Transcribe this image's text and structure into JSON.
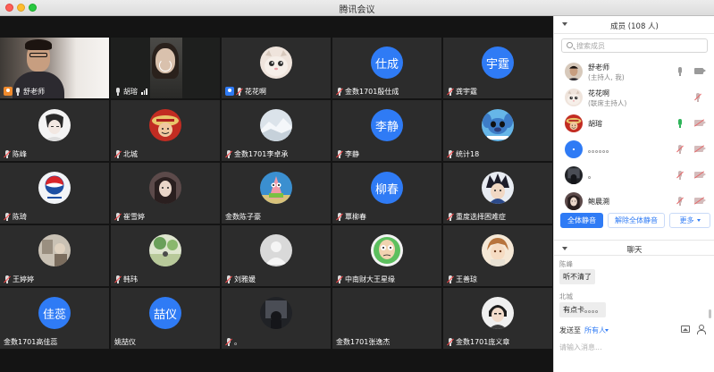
{
  "window": {
    "title": "腾讯会议"
  },
  "tiles": [
    {
      "name": "舒老师",
      "kind": "video1",
      "host": true,
      "mic": "on"
    },
    {
      "name": "胡瑢",
      "kind": "video2",
      "mic": "on",
      "active": true,
      "signal": true
    },
    {
      "name": "花花啊",
      "kind": "cat",
      "cohost": true,
      "mic": "muted"
    },
    {
      "name": "金数1701殷仕成",
      "kind": "text",
      "initials": "仕成",
      "mic": "muted"
    },
    {
      "name": "龚宇霆",
      "kind": "text",
      "initials": "宇霆",
      "mic": "muted"
    },
    {
      "name": "陈峰",
      "kind": "sketch",
      "mic": "muted"
    },
    {
      "name": "北城",
      "kind": "luffy",
      "mic": "muted"
    },
    {
      "name": "金数1701李卓承",
      "kind": "snow",
      "mic": "muted"
    },
    {
      "name": "李静",
      "kind": "text",
      "initials": "李静",
      "mic": "muted"
    },
    {
      "name": "统计18",
      "kind": "stitch",
      "mic": "muted"
    },
    {
      "name": "陈琦",
      "kind": "pepsi",
      "mic": "muted"
    },
    {
      "name": "崔雪婷",
      "kind": "girl",
      "mic": "muted"
    },
    {
      "name": "金数陈子豪",
      "kind": "patrick",
      "mic": "none"
    },
    {
      "name": "覃柳春",
      "kind": "text",
      "initials": "柳春",
      "mic": "muted"
    },
    {
      "name": "重度选择困难症",
      "kind": "anime",
      "mic": "muted"
    },
    {
      "name": "王婷婷",
      "kind": "room",
      "mic": "muted"
    },
    {
      "name": "韩玮",
      "kind": "field",
      "mic": "muted"
    },
    {
      "name": "刘雅媛",
      "kind": "default",
      "mic": "muted"
    },
    {
      "name": "中南财大王星缘",
      "kind": "morty",
      "mic": "muted"
    },
    {
      "name": "王善琼",
      "kind": "boy",
      "mic": "muted"
    },
    {
      "name": "金数1701高佳蕊",
      "kind": "text",
      "initials": "佳蕊",
      "mic": "none"
    },
    {
      "name": "姚喆仪",
      "kind": "text",
      "initials": "喆仪",
      "mic": "none"
    },
    {
      "name": "。",
      "kind": "dark",
      "mic": "muted"
    },
    {
      "name": "金数1701张逸杰",
      "kind": "blank",
      "mic": "none"
    },
    {
      "name": "金数1701庞义章",
      "kind": "portrait",
      "mic": "muted"
    }
  ],
  "sidebar": {
    "members_title": "成员 (108 人)",
    "search_placeholder": "搜索成员",
    "members": [
      {
        "name": "舒老师",
        "sub": "(主持人, 我)",
        "mic": "normal",
        "cam": "normal",
        "avatar": "teacher"
      },
      {
        "name": "花花啊",
        "sub": "(联席主持人)",
        "mic": "off",
        "cam": "none",
        "avatar": "cat"
      },
      {
        "name": "胡瑢",
        "sub": "",
        "mic": "green",
        "cam": "off",
        "avatar": "luffy"
      },
      {
        "name": "。。。。。。",
        "sub": "",
        "mic": "off",
        "cam": "off",
        "avatar": "dot"
      },
      {
        "name": "。",
        "sub": "",
        "mic": "off",
        "cam": "off",
        "avatar": "dark"
      },
      {
        "name": "鲍晨溯",
        "sub": "",
        "mic": "off",
        "cam": "off",
        "avatar": "girl"
      }
    ],
    "buttons": {
      "mute_all": "全体静音",
      "unmute_all": "解除全体静音",
      "more": "更多"
    },
    "chat_title": "聊天",
    "messages": [
      {
        "sender": "陈峰",
        "text": "听不清了"
      },
      {
        "sender": "北城",
        "text": "有点卡。。。。"
      }
    ],
    "send_to_label": "发送至",
    "send_target": "所有人",
    "input_placeholder": "请输入消息..."
  },
  "colors": {
    "accent": "#2f7bf5",
    "active_border": "#3bd16f",
    "muted": "#ff4d4f"
  }
}
